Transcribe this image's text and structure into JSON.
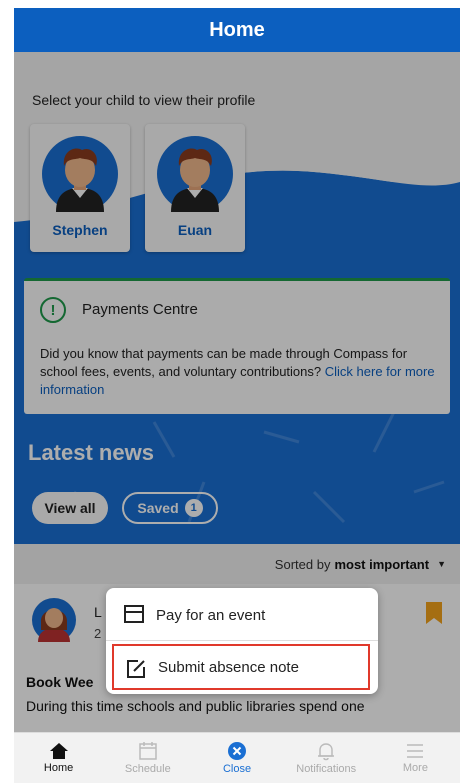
{
  "header": {
    "title": "Home"
  },
  "children_section": {
    "label": "Select your child to view their profile",
    "children": [
      {
        "name": "Stephen"
      },
      {
        "name": "Euan"
      }
    ]
  },
  "payments": {
    "icon": "exclamation-circle-icon",
    "title": "Payments Centre",
    "body": "Did you know that payments can be made through Compass for school fees, events, and voluntary contributions?",
    "link": "Click here for more information"
  },
  "news": {
    "title": "Latest news",
    "view_all": "View all",
    "saved_label": "Saved",
    "saved_count": "1",
    "sort_prefix": "Sorted by",
    "sort_value": "most important",
    "item": {
      "author_initial": "L",
      "date_partial": "2",
      "headline": "Book Wee",
      "snippet": "During this time schools and public libraries spend one"
    }
  },
  "popup_menu": {
    "items": [
      {
        "label": "Pay for an event",
        "icon": "card-icon"
      },
      {
        "label": "Submit absence note",
        "icon": "edit-note-icon"
      }
    ]
  },
  "tabbar": {
    "tabs": [
      {
        "label": "Home",
        "icon": "home-icon",
        "state": "active"
      },
      {
        "label": "Schedule",
        "icon": "calendar-icon",
        "state": "inactive"
      },
      {
        "label": "Close",
        "icon": "close-circle-icon",
        "state": "close"
      },
      {
        "label": "Notifications",
        "icon": "bell-icon",
        "state": "inactive"
      },
      {
        "label": "More",
        "icon": "menu-icon",
        "state": "inactive"
      }
    ]
  },
  "colors": {
    "brand_blue": "#0c5fbf",
    "accent_blue": "#1a6fd3",
    "success_green": "#1e9a4a",
    "highlight_red": "#e0392b",
    "bookmark_orange": "#f3a21b"
  }
}
